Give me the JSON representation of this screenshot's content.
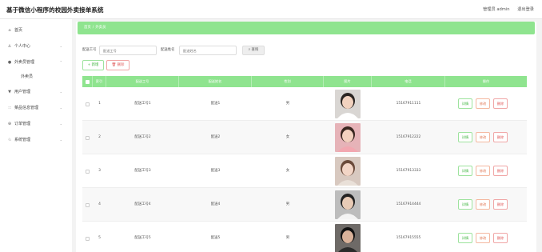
{
  "header": {
    "title": "基于微信小程序的校园外卖接单系统",
    "user_label": "管理员 admin",
    "logout_label": "退出登录"
  },
  "sidebar": {
    "items": [
      {
        "label": "首页",
        "icon": "home-icon"
      },
      {
        "label": "个人中心",
        "icon": "user-icon"
      },
      {
        "label": "外卖员管理",
        "icon": "courier-icon"
      },
      {
        "label": "外卖员",
        "icon": ""
      },
      {
        "label": "用户管理",
        "icon": "users-icon"
      },
      {
        "label": "菜品信息管理",
        "icon": "grid-icon"
      },
      {
        "label": "订单管理",
        "icon": "order-icon"
      },
      {
        "label": "系统管理",
        "icon": "system-icon"
      }
    ]
  },
  "breadcrumb": {
    "home": "首页",
    "separator": "/",
    "current": "外卖员"
  },
  "search": {
    "field1_label": "配送工号",
    "field1_placeholder": "配送工号",
    "field2_label": "配送姓名",
    "field2_placeholder": "配送姓名",
    "button_label": "查询"
  },
  "actions": {
    "add_label": "+ 新增",
    "delete_label": "删除"
  },
  "table": {
    "headers": [
      "索引",
      "配送工号",
      "配送姓名",
      "性别",
      "图片",
      "电话",
      "操作"
    ],
    "op_labels": {
      "detail": "详情",
      "edit": "修改",
      "delete": "删除"
    },
    "rows": [
      {
        "index": "1",
        "number": "配送工号1",
        "name": "配送1",
        "gender": "男",
        "phone": "15167911111"
      },
      {
        "index": "2",
        "number": "配送工号2",
        "name": "配送2",
        "gender": "女",
        "phone": "15167912222"
      },
      {
        "index": "3",
        "number": "配送工号3",
        "name": "配送3",
        "gender": "女",
        "phone": "15167913333"
      },
      {
        "index": "4",
        "number": "配送工号4",
        "name": "配送4",
        "gender": "男",
        "phone": "15167914444"
      },
      {
        "index": "5",
        "number": "配送工号5",
        "name": "配送5",
        "gender": "男",
        "phone": "15167915555"
      }
    ]
  },
  "colors": {
    "accent": "#8fe48f",
    "danger": "#e05a5a",
    "success": "#3db43d"
  }
}
